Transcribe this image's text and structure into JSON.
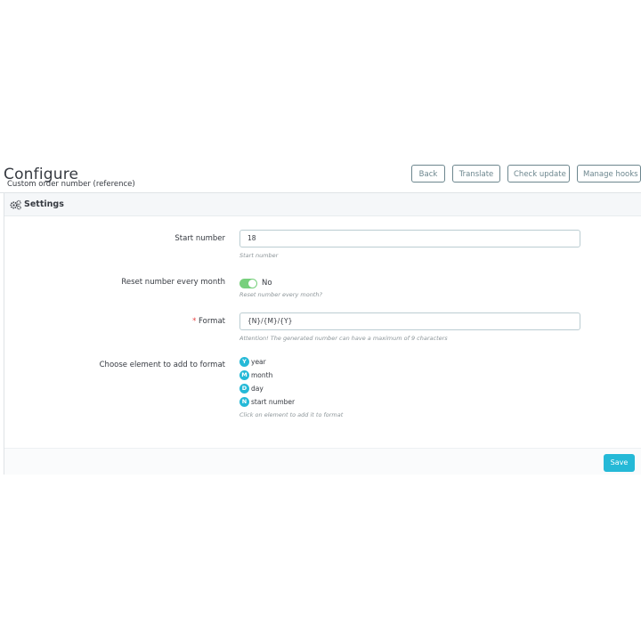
{
  "header": {
    "title": "Configure",
    "subtitle": "Custom order number (reference)"
  },
  "toolbar": {
    "buttons": [
      {
        "label": "Back"
      },
      {
        "label": "Translate"
      },
      {
        "label": "Check update"
      },
      {
        "label": "Manage hooks"
      }
    ]
  },
  "panel": {
    "heading": "Settings",
    "heading_icon": "gears-icon",
    "fields": {
      "start_number": {
        "label": "Start number",
        "value": "18",
        "help": "Start number"
      },
      "reset_monthly": {
        "label": "Reset number every month",
        "state": "No",
        "help": "Reset number every month?"
      },
      "format": {
        "required_mark": "*",
        "label": "Format",
        "value": "{N}/{M}/{Y}",
        "help": "Attention! The generated number can have a maximum of 9 characters"
      },
      "elements": {
        "label": "Choose element to add to format",
        "items": [
          {
            "letter": "Y",
            "label": "year"
          },
          {
            "letter": "M",
            "label": "month"
          },
          {
            "letter": "D",
            "label": "day"
          },
          {
            "letter": "N",
            "label": "start number"
          }
        ],
        "help": "Click on element to add it to format"
      }
    },
    "save_label": "Save"
  },
  "colors": {
    "accent": "#25b9d7",
    "switch_on": "#78d07d",
    "required": "#e64242",
    "button_border": "#6c868e"
  }
}
